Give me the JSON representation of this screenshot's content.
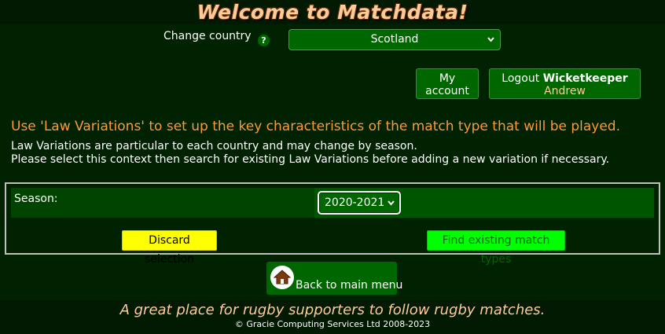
{
  "header": {
    "title": "Welcome to Matchdata!"
  },
  "country": {
    "label": "Change country",
    "help": "?",
    "selected": "Scotland"
  },
  "account": {
    "my_account": "My account",
    "logout_prefix": "Logout",
    "username": "Wicketkeeper",
    "firstname": "Andrew"
  },
  "intro": {
    "headline": "Use 'Law Variations' to set up the key characteristics of the match type that will be played.",
    "line1": "Law Variations are particular to each country and may change by season.",
    "line2": "Please select this context then search for existing Law Variations before adding a new variation if necessary."
  },
  "form": {
    "season_label": "Season:",
    "season_value": "2020-2021",
    "discard_label": "Discard selection",
    "find_label": "Find existing match types"
  },
  "nav": {
    "back_label": "Back to main menu"
  },
  "footer": {
    "tagline": "A great place for rugby supporters to follow rugby matches.",
    "copyright": "© Gracie Computing Services Ltd 2008-2023"
  },
  "icons": {
    "help": "help-icon",
    "home": "home-icon",
    "dropdown": "chevron-down-icon"
  },
  "colors": {
    "background": "#002200",
    "accent": "#ff9933",
    "button": "#006600",
    "discard": "#ffff00",
    "find": "#00ff00"
  }
}
